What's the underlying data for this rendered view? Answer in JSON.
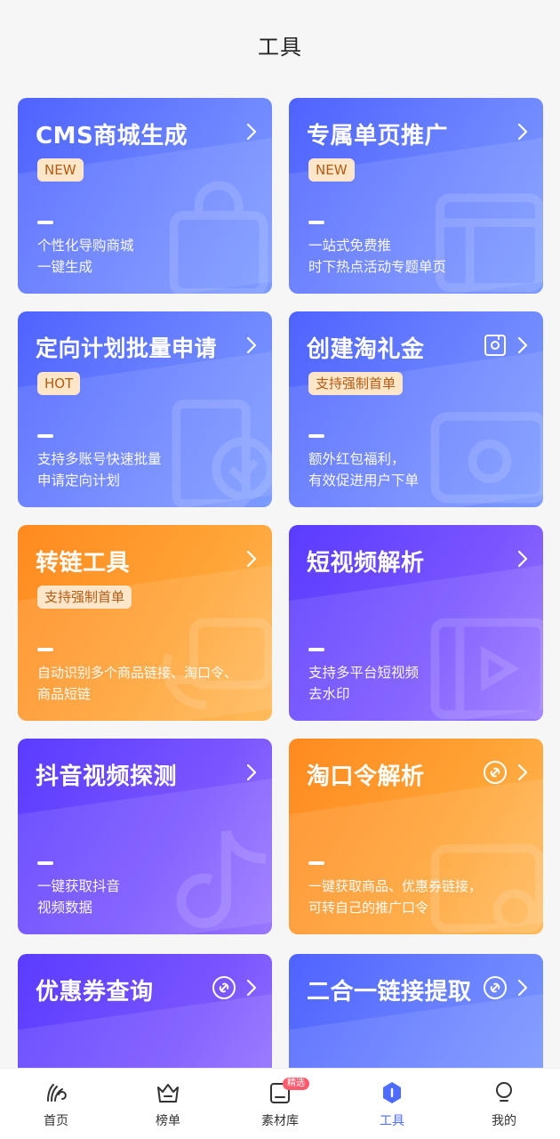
{
  "header": {
    "title": "工具"
  },
  "cards": [
    {
      "title": "CMS商城生成",
      "badge": "NEW",
      "desc_line1": "个性化导购商城",
      "desc_line2": "一键生成",
      "color": "#4e63ff",
      "icon": "chevron-right-icon"
    },
    {
      "title": "专属单页推广",
      "badge": "NEW",
      "desc_line1": "一站式免费推",
      "desc_line2": "时下热点活动专题单页",
      "color": "#4e63ff",
      "icon": "chevron-right-icon"
    },
    {
      "title": "定向计划批量申请",
      "badge": "HOT",
      "desc_line1": "支持多账号快速批量",
      "desc_line2": "申请定向计划",
      "color": "#4e63ff",
      "icon": "chevron-right-icon"
    },
    {
      "title": "创建淘礼金",
      "badge": "支持强制首单",
      "desc_line1": "额外红包福利，",
      "desc_line2": "有效促进用户下单",
      "color": "#4e63ff",
      "icon": "gift-card-icon"
    },
    {
      "title": "转链工具",
      "badge": "支持强制首单",
      "desc_line1": "自动识别多个商品链接、淘口令、",
      "desc_line2": "商品短链",
      "color": "#ff8a1f",
      "icon": "chevron-right-icon"
    },
    {
      "title": "短视频解析",
      "badge": "",
      "desc_line1": "支持多平台短视频",
      "desc_line2": "去水印",
      "color": "#5b3bff",
      "icon": "chevron-right-icon"
    },
    {
      "title": "抖音视频探测",
      "badge": "",
      "desc_line1": "一键获取抖音",
      "desc_line2": "视频数据",
      "color": "#5b3bff",
      "icon": "chevron-right-icon"
    },
    {
      "title": "淘口令解析",
      "badge": "",
      "desc_line1": "一键获取商品、优惠券链接，",
      "desc_line2": "可转自己的推广口令",
      "color": "#ff8a1f",
      "icon": "link-icon"
    },
    {
      "title": "优惠券查询",
      "badge": "",
      "desc_line1": "",
      "desc_line2": "",
      "color": "#5b3bff",
      "icon": "link-icon"
    },
    {
      "title": "二合一链接提取",
      "badge": "",
      "desc_line1": "",
      "desc_line2": "",
      "color": "#4e63ff",
      "icon": "link-icon"
    }
  ],
  "tabbar": {
    "items": [
      {
        "label": "首页",
        "icon": "home-icon",
        "active": false
      },
      {
        "label": "榜单",
        "icon": "crown-basket-icon",
        "active": false
      },
      {
        "label": "素材库",
        "icon": "material-icon",
        "active": false,
        "tag": "精选"
      },
      {
        "label": "工具",
        "icon": "tools-hexagon-icon",
        "active": true
      },
      {
        "label": "我的",
        "icon": "bulb-icon",
        "active": false
      }
    ],
    "active_color": "#4e6cff"
  }
}
